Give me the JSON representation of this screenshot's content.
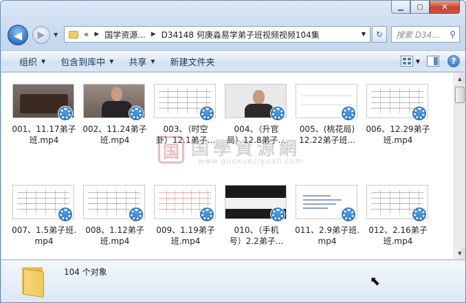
{
  "window": {
    "caption_buttons": [
      "minimize",
      "maximize",
      "close"
    ]
  },
  "nav": {
    "back_label": "◀",
    "forward_label": "▶",
    "breadcrumbs": [
      "«",
      "国学资源...",
      "D34148 何庚淼易学弟子班视频视频104集"
    ],
    "search_placeholder": "搜索 D34..."
  },
  "toolbar": {
    "organize": "组织",
    "include_library": "包含到库中",
    "share": "共享",
    "new_folder": "新建文件夹"
  },
  "files": [
    {
      "line1": "001、11.17弟子",
      "line2": "班.mp4",
      "thumb": "room"
    },
    {
      "line1": "002、11.24弟子",
      "line2": "班.mp4",
      "thumb": "person"
    },
    {
      "line1": "003、（时空",
      "line2": "卦）12.1弟子...",
      "thumb": "scribble"
    },
    {
      "line1": "004、（升官",
      "line2": "局）12.8弟子...",
      "thumb": "person2"
    },
    {
      "line1": "005、(桃花局)",
      "line2": "12.22弟子班...",
      "thumb": "light"
    },
    {
      "line1": "006、12.29弟子",
      "line2": "班.mp4",
      "thumb": "scribble"
    },
    {
      "line1": "007、1.5弟子班.",
      "line2": "mp4",
      "thumb": "scribble"
    },
    {
      "line1": "008、1.12弟子",
      "line2": "班.mp4",
      "thumb": "scribble"
    },
    {
      "line1": "009、1.19弟子",
      "line2": "班.mp4",
      "thumb": "red"
    },
    {
      "line1": "010、（手机",
      "line2": "号）2.2弟子...",
      "thumb": "dark"
    },
    {
      "line1": "011、2.9弟子班.",
      "line2": "mp4",
      "thumb": "slide"
    },
    {
      "line1": "012、2.16弟子",
      "line2": "班.mp4",
      "thumb": "scribble"
    }
  ],
  "watermark": {
    "seal": "国",
    "chinese": "国學資源網",
    "url": "www.guoxueziyuan.com"
  },
  "status": {
    "count_text": "104 个对象"
  },
  "colors": {
    "accent": "#2f72c6",
    "chrome": "#c6d8ee",
    "close_red": "#c7422b"
  }
}
